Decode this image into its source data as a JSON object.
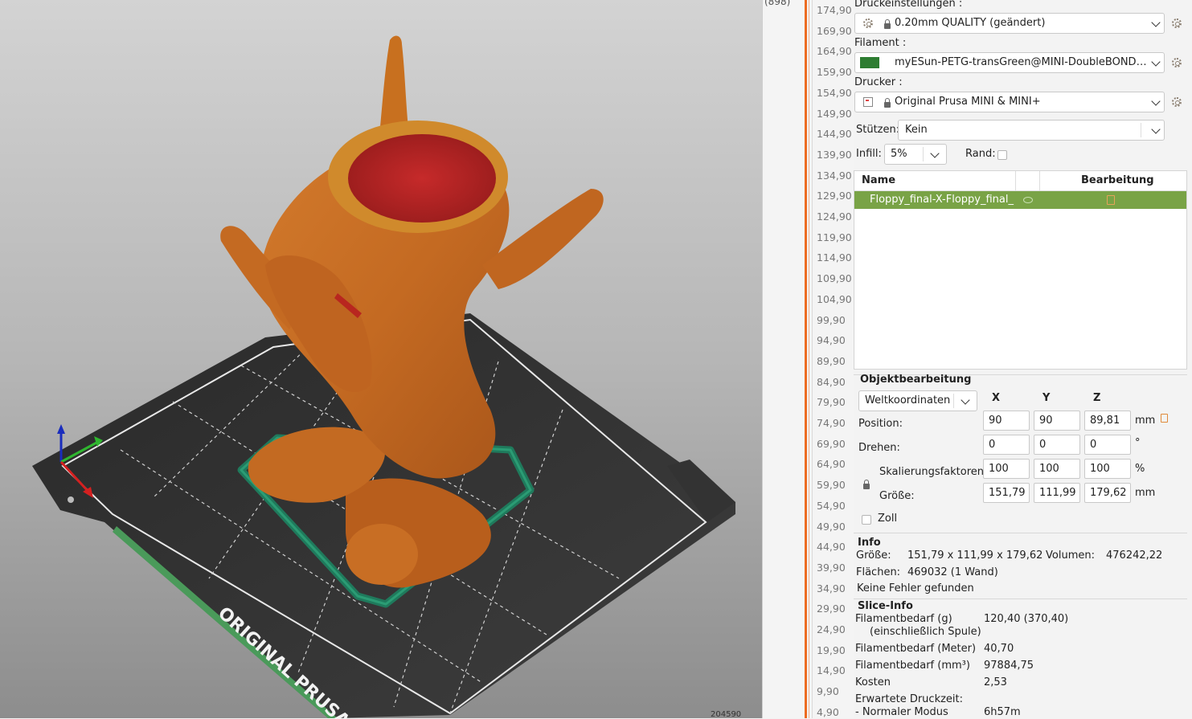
{
  "viewport": {
    "bed_text": "ORIGINAL PRUSA",
    "bottom_readout": "204590"
  },
  "layer_strip": {
    "top_readout": "(898)"
  },
  "ruler": {
    "ticks": [
      "174,90",
      "169,90",
      "164,90",
      "159,90",
      "154,90",
      "149,90",
      "144,90",
      "139,90",
      "134,90",
      "129,90",
      "124,90",
      "119,90",
      "114,90",
      "109,90",
      "104,90",
      "99,90",
      "94,90",
      "89,90",
      "84,90",
      "79,90",
      "74,90",
      "69,90",
      "64,90",
      "59,90",
      "54,90",
      "49,90",
      "44,90",
      "39,90",
      "34,90",
      "29,90",
      "24,90",
      "19,90",
      "14,90",
      "9,90",
      "4,90"
    ]
  },
  "print_settings": {
    "label": "Druckeinstellungen :",
    "value": "0.20mm QUALITY (geändert)"
  },
  "filament": {
    "label": "Filament :",
    "value": "myESun-PETG-transGreen@MINI-DoubleBONDT (...",
    "color": "#2e7d32"
  },
  "printer": {
    "label": "Drucker :",
    "value": "Original Prusa MINI & MINI+"
  },
  "supports": {
    "label": "Stützen:",
    "value": "Kein"
  },
  "infill": {
    "label": "Infill:",
    "value": "5%"
  },
  "brim": {
    "label": "Rand:",
    "checked": false
  },
  "object_list": {
    "col_name": "Name",
    "col_edit": "Bearbeitung",
    "rows": [
      {
        "name": "Floppy_final-X-Floppy_final_I"
      }
    ]
  },
  "object_manipulation": {
    "title": "Objektbearbeitung",
    "coord_system": "Weltkoordinaten",
    "axes": [
      "X",
      "Y",
      "Z"
    ],
    "position": {
      "label": "Position:",
      "values": [
        "90",
        "90",
        "89,81"
      ],
      "unit": "mm"
    },
    "rotation": {
      "label": "Drehen:",
      "values": [
        "0",
        "0",
        "0"
      ],
      "unit": "°"
    },
    "scale": {
      "label": "Skalierungsfaktoren:",
      "values": [
        "100",
        "100",
        "100"
      ],
      "unit": "%"
    },
    "size": {
      "label": "Größe:",
      "values": [
        "151,79",
        "111,99",
        "179,62"
      ],
      "unit": "mm"
    },
    "inches": {
      "label": "Zoll",
      "checked": false
    }
  },
  "info": {
    "title": "Info",
    "size_label": "Größe:",
    "size_value": "151,79 x 111,99 x 179,62",
    "volume_label": "Volumen:",
    "volume_value": "476242,22",
    "facets_label": "Flächen:",
    "facets_value": "469032 (1 Wand)",
    "errors": "Keine Fehler gefunden"
  },
  "slice_info": {
    "title": "Slice-Info",
    "rows": [
      {
        "label": "Filamentbedarf (g)",
        "value": "120,40 (370,40)"
      },
      {
        "label": "(einschließlich Spule)",
        "value": ""
      },
      {
        "label": "Filamentbedarf (Meter)",
        "value": "40,70"
      },
      {
        "label": "Filamentbedarf (mm³)",
        "value": "97884,75"
      },
      {
        "label": "Kosten",
        "value": "2,53"
      },
      {
        "label": "Erwartete Druckzeit:",
        "value": ""
      },
      {
        "label": "- Normaler Modus",
        "value": "6h57m"
      }
    ]
  }
}
